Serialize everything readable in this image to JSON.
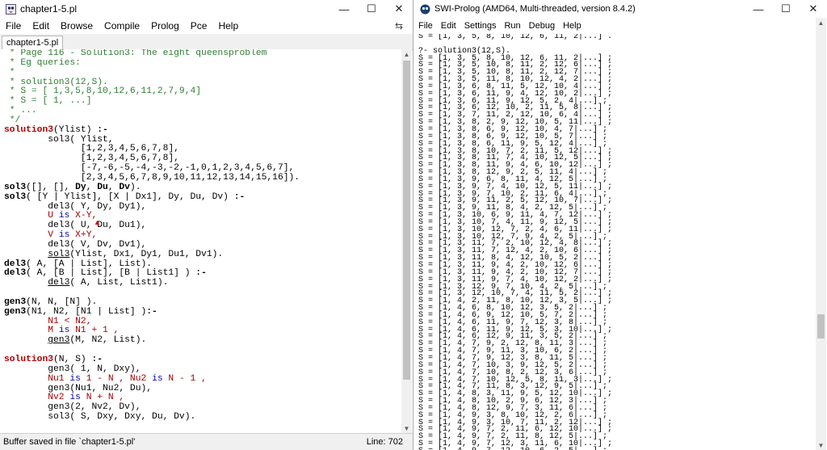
{
  "editor": {
    "title": "chapter1-5.pl",
    "menu": [
      "File",
      "Edit",
      "Browse",
      "Compile",
      "Prolog",
      "Pce",
      "Help"
    ],
    "tab": "chapter1-5.pl",
    "status_message": "Buffer saved in file `chapter1-5.pl'",
    "line_indicator": "Line: 702",
    "code_lines": [
      [
        {
          "t": " * Page 116 - Solution3: The eight queensproblem",
          "c": "c"
        }
      ],
      [
        {
          "t": " * Eg queries:",
          "c": "c"
        }
      ],
      [
        {
          "t": " *",
          "c": "c"
        }
      ],
      [
        {
          "t": " * solution3(12,S).",
          "c": "c"
        }
      ],
      [
        {
          "t": " * S = [ 1,3,5,8,10,12,6,11,2,7,9,4]",
          "c": "c"
        }
      ],
      [
        {
          "t": " * S = [ 1, ...]",
          "c": "c"
        }
      ],
      [
        {
          "t": " * ...",
          "c": "c"
        }
      ],
      [
        {
          "t": " */",
          "c": "c"
        }
      ],
      [
        {
          "t": "solution3",
          "c": "h"
        },
        {
          "t": "(Ylist) ",
          "c": ""
        },
        {
          "t": ":-",
          "c": "p"
        }
      ],
      [
        {
          "t": "        sol3( Ylist,",
          "c": ""
        }
      ],
      [
        {
          "t": "              [1,2,3,4,5,6,7,8],",
          "c": ""
        }
      ],
      [
        {
          "t": "              [1,2,3,4,5,6,7,8],",
          "c": ""
        }
      ],
      [
        {
          "t": "              [-7,-6,-5,-4,-3,-2,-1,0,1,2,3,4,5,6,7],",
          "c": ""
        }
      ],
      [
        {
          "t": "              [2,3,4,5,6,7,8,9,10,11,12,13,14,15,16]).",
          "c": ""
        }
      ],
      [
        {
          "t": "sol3",
          "c": "p"
        },
        {
          "t": "([], [], ",
          "c": ""
        },
        {
          "t": "Dy",
          "c": "p"
        },
        {
          "t": ", ",
          "c": ""
        },
        {
          "t": "Du",
          "c": "p"
        },
        {
          "t": ", ",
          "c": ""
        },
        {
          "t": "Dv",
          "c": "p"
        },
        {
          "t": ").",
          "c": ""
        }
      ],
      [
        {
          "t": "sol3",
          "c": "p"
        },
        {
          "t": "( [Y | Ylist], [X | Dx1], Dy, Du, Dv) ",
          "c": ""
        },
        {
          "t": ":-",
          "c": "p"
        }
      ],
      [
        {
          "t": "        del3( Y, Dy, Dy1),",
          "c": ""
        }
      ],
      [
        {
          "t": "        U ",
          "c": "v"
        },
        {
          "t": "is",
          "c": "k"
        },
        {
          "t": " X-Y,",
          "c": "v"
        }
      ],
      [
        {
          "t": "        del3( U, Du, Du1),",
          "c": ""
        }
      ],
      [
        {
          "t": "        V ",
          "c": "v"
        },
        {
          "t": "is",
          "c": "k"
        },
        {
          "t": " X+Y,",
          "c": "v"
        }
      ],
      [
        {
          "t": "        del3( V, Dv, Dv1),",
          "c": ""
        }
      ],
      [
        {
          "t": "        ",
          "c": ""
        },
        {
          "t": "sol3",
          "c": "u"
        },
        {
          "t": "(Ylist, Dx1, Dy1, Du1, Dv1).",
          "c": ""
        }
      ],
      [
        {
          "t": "del3",
          "c": "p"
        },
        {
          "t": "( A, [A | List], List).",
          "c": ""
        }
      ],
      [
        {
          "t": "del3",
          "c": "p"
        },
        {
          "t": "( A, [B | List], [B | List1] ) ",
          "c": ""
        },
        {
          "t": ":-",
          "c": "p"
        }
      ],
      [
        {
          "t": "        ",
          "c": ""
        },
        {
          "t": "del3",
          "c": "u"
        },
        {
          "t": "( A, List, List1).",
          "c": ""
        }
      ],
      [
        {
          "t": "",
          "c": ""
        }
      ],
      [
        {
          "t": "gen3",
          "c": "p"
        },
        {
          "t": "(N, N, [N] ).",
          "c": ""
        }
      ],
      [
        {
          "t": "gen3",
          "c": "p"
        },
        {
          "t": "(N1, N2, [N1 | List] )",
          "c": ""
        },
        {
          "t": ":-",
          "c": "p"
        }
      ],
      [
        {
          "t": "        N1 < N2,",
          "c": "v"
        }
      ],
      [
        {
          "t": "        M ",
          "c": "v"
        },
        {
          "t": "is",
          "c": "k"
        },
        {
          "t": " N1 + 1 ,",
          "c": "v"
        }
      ],
      [
        {
          "t": "        ",
          "c": ""
        },
        {
          "t": "gen3",
          "c": "u"
        },
        {
          "t": "(M, N2, List).",
          "c": ""
        }
      ],
      [
        {
          "t": "",
          "c": ""
        }
      ],
      [
        {
          "t": "solution3",
          "c": "h"
        },
        {
          "t": "(N, S) ",
          "c": ""
        },
        {
          "t": ":-",
          "c": "p"
        }
      ],
      [
        {
          "t": "        gen3( 1, N, Dxy),",
          "c": ""
        }
      ],
      [
        {
          "t": "        Nu1 ",
          "c": "v"
        },
        {
          "t": "is",
          "c": "k"
        },
        {
          "t": " 1 - N , Nu2 ",
          "c": "v"
        },
        {
          "t": "is",
          "c": "k"
        },
        {
          "t": " N - 1 ,",
          "c": "v"
        }
      ],
      [
        {
          "t": "        gen3(Nu1, Nu2, Du),",
          "c": ""
        }
      ],
      [
        {
          "t": "        Nv2 ",
          "c": "v"
        },
        {
          "t": "is",
          "c": "k"
        },
        {
          "t": " N + N ,",
          "c": "v"
        }
      ],
      [
        {
          "t": "        gen3(2, Nv2, Dv),",
          "c": ""
        }
      ],
      [
        {
          "t": "        sol3( S, Dxy, Dxy, Du, Dv).",
          "c": ""
        }
      ]
    ]
  },
  "console": {
    "title": "SWI-Prolog (AMD64, Multi-threaded, version 8.4.2)",
    "menu": [
      "File",
      "Edit",
      "Settings",
      "Run",
      "Debug",
      "Help"
    ],
    "lines": [
      "S = [1, 3, 5, 8, 10, 12, 6, 11, 2|...] .",
      "",
      "?- solution3(12,S).",
      "S = [1, 3, 5, 8, 10, 12, 6, 11, 2|...] ;",
      "S = [1, 3, 5, 10, 8, 11, 2, 12, 6|...] ;",
      "S = [1, 3, 5, 10, 8, 11, 2, 12, 7|...] ;",
      "S = [1, 3, 5, 11, 8, 10, 12, 4, 2|...] ;",
      "S = [1, 3, 6, 8, 11, 5, 12, 10, 4|...] ;",
      "S = [1, 3, 6, 11, 9, 4, 12, 10, 2|...] ;",
      "S = [1, 3, 6, 11, 9, 12, 5, 2, 4|...] ;",
      "S = [1, 3, 6, 12, 10, 2, 11, 5, 8|...] ;",
      "S = [1, 3, 7, 11, 2, 12, 10, 6, 4|...] ;",
      "S = [1, 3, 8, 2, 9, 12, 10, 5, 11|...] ;",
      "S = [1, 3, 8, 6, 9, 12, 10, 4, 7|...] ;",
      "S = [1, 3, 8, 6, 9, 12, 10, 5, 7|...] ;",
      "S = [1, 3, 8, 6, 11, 9, 5, 12, 4|...] ;",
      "S = [1, 3, 8, 10, 7, 2, 11, 5, 12|...] ;",
      "S = [1, 3, 8, 11, 7, 4, 10, 12, 5|...] ;",
      "S = [1, 3, 8, 11, 9, 4, 6, 10, 12|...] ;",
      "S = [1, 3, 8, 12, 9, 2, 5, 11, 4|...] ;",
      "S = [1, 3, 9, 6, 8, 11, 4, 12, 5|...] ;",
      "S = [1, 3, 9, 7, 4, 10, 12, 5, 11|...] ;",
      "S = [1, 3, 9, 7, 10, 2, 11, 6, 4|...] ;",
      "S = [1, 3, 9, 11, 2, 5, 12, 10, 7|...] ;",
      "S = [1, 3, 9, 11, 8, 4, 2, 12, 5|...] ;",
      "S = [1, 3, 10, 6, 9, 11, 4, 7, 12|...] ;",
      "S = [1, 3, 10, 7, 4, 11, 9, 12, 5|...] ;",
      "S = [1, 3, 10, 12, 7, 2, 4, 6, 11|...] ;",
      "S = [1, 3, 10, 12, 7, 9, 4, 2, 5|...] ;",
      "S = [1, 3, 11, 7, 2, 10, 12, 4, 8|...] ;",
      "S = [1, 3, 11, 7, 12, 4, 2, 10, 6|...] ;",
      "S = [1, 3, 11, 8, 4, 12, 10, 5, 2|...] ;",
      "S = [1, 3, 11, 9, 4, 2, 10, 12, 6|...] ;",
      "S = [1, 3, 11, 9, 4, 2, 10, 12, 7|...] ;",
      "S = [1, 3, 11, 9, 7, 4, 10, 12, 2|...] ;",
      "S = [1, 3, 12, 9, 7, 10, 4, 2, 5|...] ;",
      "S = [1, 3, 12, 10, 7, 4, 11, 5, 2|...] ;",
      "S = [1, 4, 2, 11, 8, 10, 12, 3, 5|...] ;",
      "S = [1, 4, 6, 8, 10, 12, 3, 5, 2|...] ;",
      "S = [1, 4, 6, 9, 12, 10, 5, 7, 2|...] ;",
      "S = [1, 4, 6, 11, 9, 7, 12, 3, 8|...] ;",
      "S = [1, 4, 6, 11, 9, 12, 5, 3, 10|...] ;",
      "S = [1, 4, 6, 12, 9, 11, 3, 5, 2|...] ;",
      "S = [1, 4, 7, 9, 2, 12, 8, 11, 3|...] ;",
      "S = [1, 4, 7, 9, 11, 3, 10, 6, 2|...] ;",
      "S = [1, 4, 7, 9, 12, 3, 8, 11, 5|...] ;",
      "S = [1, 4, 7, 10, 3, 9, 12, 5, 2|...] ;",
      "S = [1, 4, 7, 10, 8, 2, 12, 3, 6|...] ;",
      "S = [1, 4, 7, 10, 12, 5, 8, 11, 3|...] ;",
      "S = [1, 4, 7, 11, 8, 3, 12, 9, 5|...] ;",
      "S = [1, 4, 8, 3, 11, 9, 5, 12, 10|...] ;",
      "S = [1, 4, 8, 10, 2, 9, 6, 12, 3|...] ;",
      "S = [1, 4, 8, 12, 9, 7, 3, 11, 6|...] ;",
      "S = [1, 4, 9, 3, 8, 10, 12, 2, 6|...] ;",
      "S = [1, 4, 9, 3, 10, 7, 11, 2, 12|...] ;",
      "S = [1, 4, 9, 7, 2, 11, 6, 12, 10|...] ;",
      "S = [1, 4, 9, 7, 2, 11, 8, 12, 5|...] ;",
      "S = [1, 4, 9, 7, 12, 3, 11, 6, 10|...] ;",
      "S = [1, 4, 9, 7, 12, 10, 6, 2, 5|...] ;",
      "S = [1, 4, 9, 11, 6, 3, 10, 12, 5|...]"
    ]
  }
}
